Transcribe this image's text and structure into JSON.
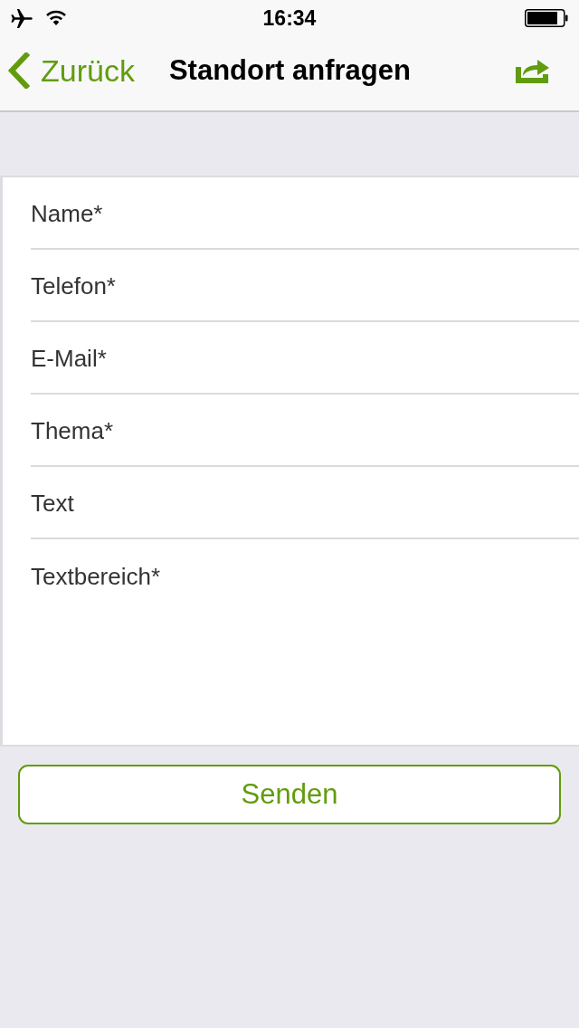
{
  "status_bar": {
    "time": "16:34"
  },
  "nav_bar": {
    "back_label": "Zurück",
    "title": "Standort anfragen"
  },
  "form": {
    "fields": [
      {
        "kind": "input",
        "placeholder": "Name*"
      },
      {
        "kind": "input",
        "placeholder": "Telefon*"
      },
      {
        "kind": "input",
        "placeholder": "E-Mail*"
      },
      {
        "kind": "input",
        "placeholder": "Thema*"
      },
      {
        "kind": "input",
        "placeholder": "Text"
      },
      {
        "kind": "textarea",
        "placeholder": "Textbereich*"
      }
    ]
  },
  "submit_button": {
    "label": "Senden"
  }
}
